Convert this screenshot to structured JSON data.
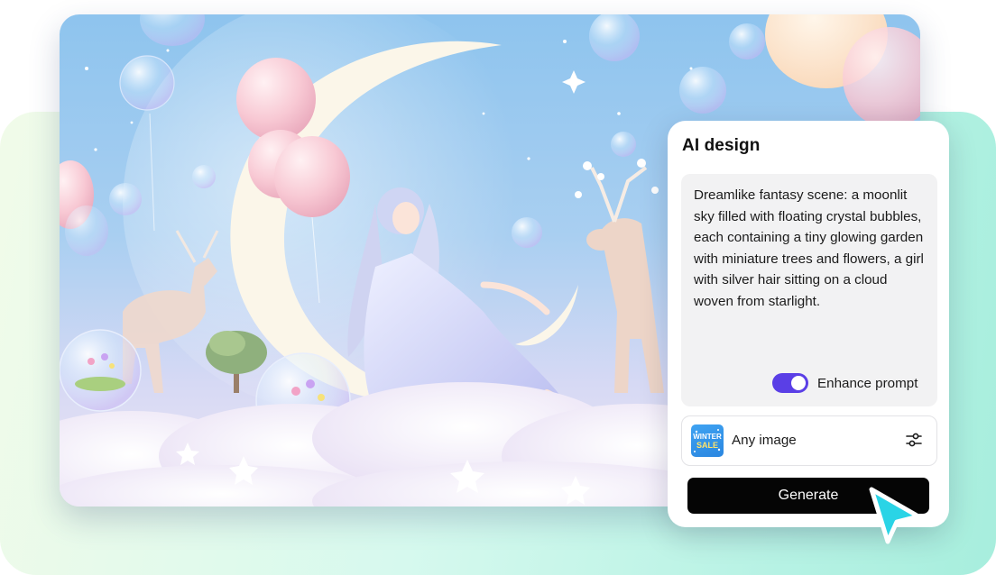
{
  "panel": {
    "title": "AI design",
    "prompt": "Dreamlike fantasy scene: a moonlit sky filled with floating crystal bubbles, each containing a tiny glowing garden with miniature trees and flowers, a girl with silver hair sitting on a cloud woven from starlight.",
    "enhance": {
      "label": "Enhance prompt",
      "enabled": true
    },
    "reference": {
      "label": "Any image",
      "thumbnail_text": [
        "WINTER",
        "SALE"
      ],
      "settings_icon": "sliders-icon"
    },
    "generate_label": "Generate"
  },
  "colors": {
    "accent": "#5a3fe6",
    "button": "#050505",
    "cursor": "#2ad4e6",
    "backdrop": "#b6f2e4"
  },
  "illustration": {
    "subject": "girl with silver hair sitting on a cloud",
    "elements": [
      "crescent moon",
      "balloons",
      "crystal bubbles",
      "deer",
      "stars",
      "clouds",
      "tree"
    ]
  }
}
